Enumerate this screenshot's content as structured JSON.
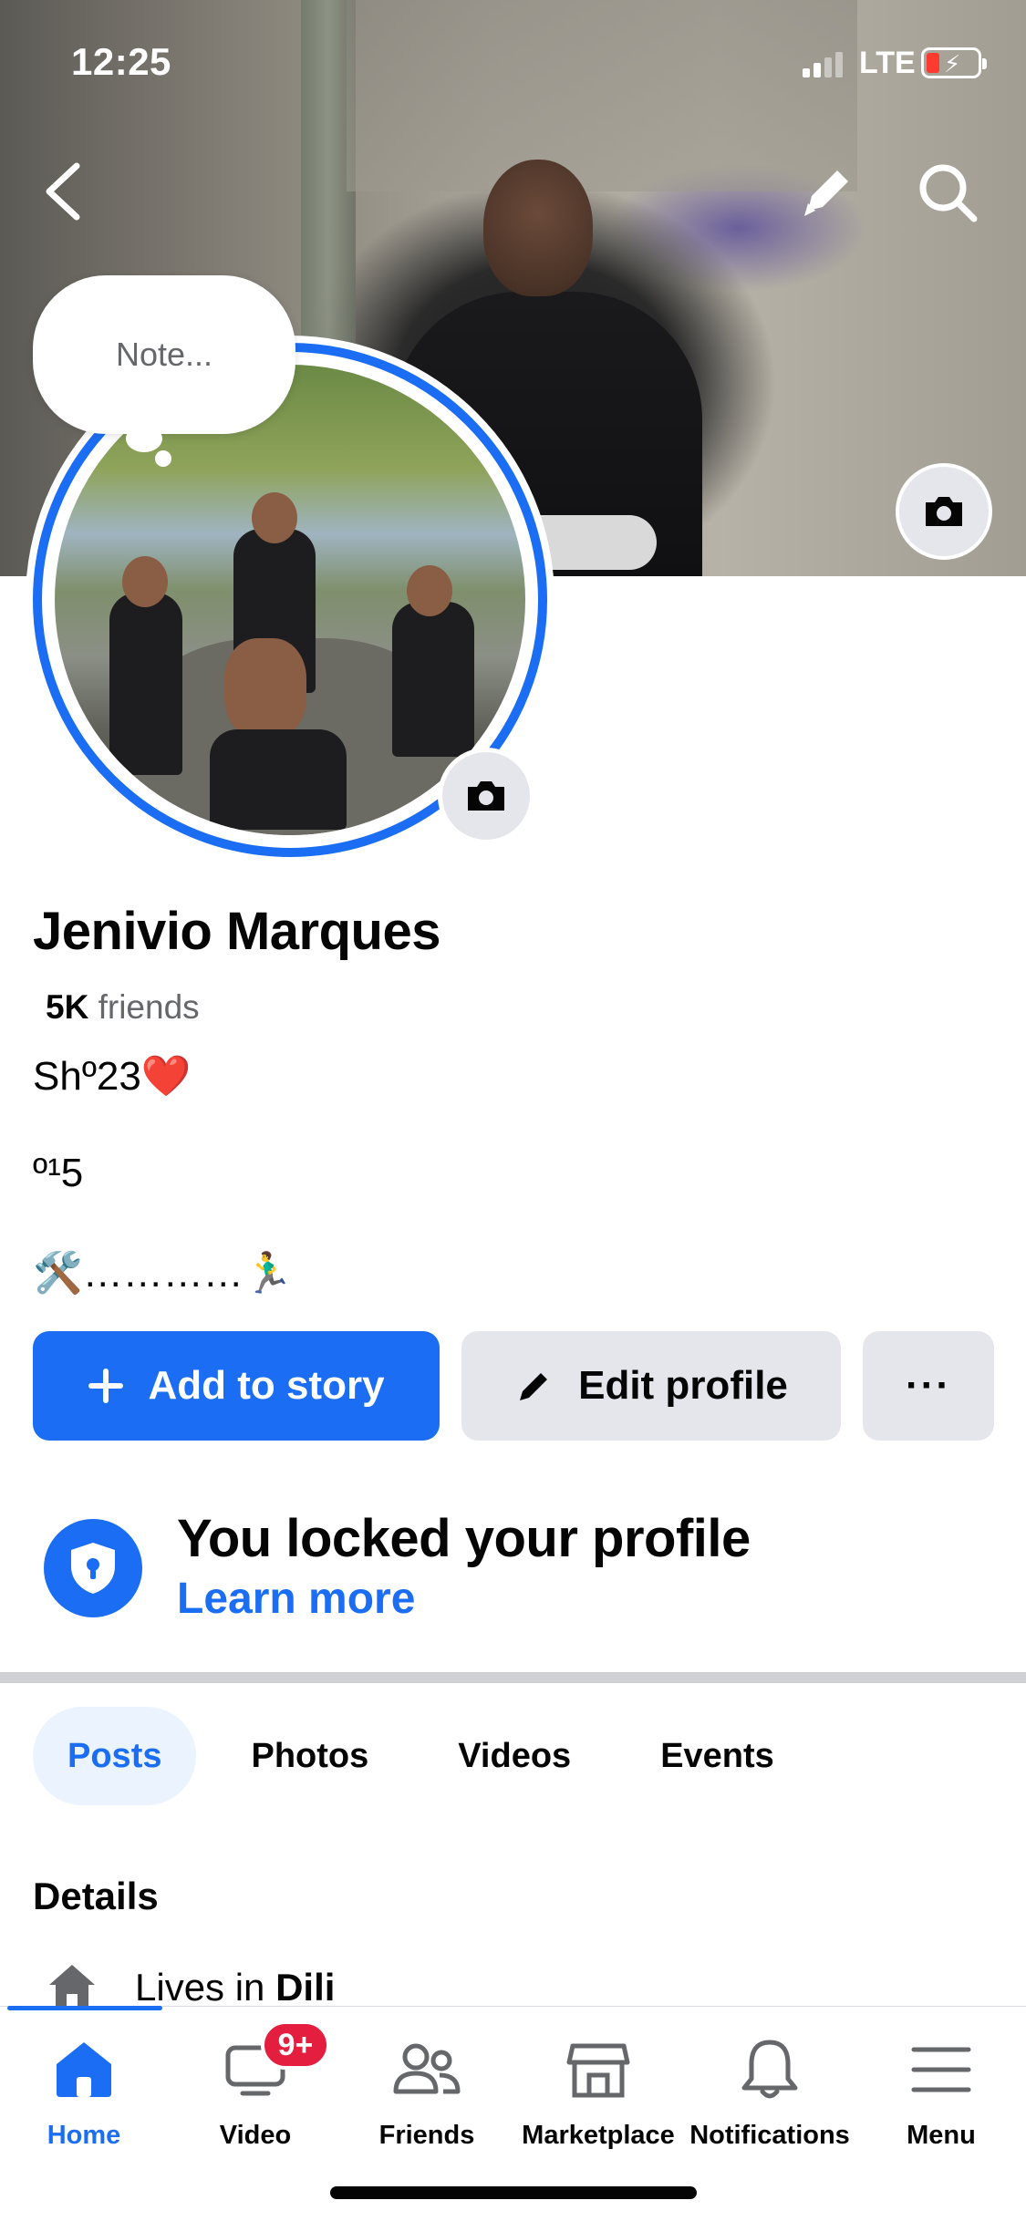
{
  "status_bar": {
    "time": "12:25",
    "network": "LTE"
  },
  "cover": {
    "has_camera": true
  },
  "note": {
    "placeholder": "Note..."
  },
  "profile": {
    "name": "Jenivio Marques",
    "friends_count": "5K",
    "friends_label": "friends",
    "bio_lines": [
      "Shº23❤️",
      "º¹5",
      "🛠️…………🏃‍♂️"
    ]
  },
  "actions": {
    "add_story": "Add to story",
    "edit_profile": "Edit profile",
    "more": "···"
  },
  "lock_notice": {
    "title": "You locked your profile",
    "link": "Learn more"
  },
  "tabs": [
    {
      "label": "Posts",
      "active": true
    },
    {
      "label": "Photos",
      "active": false
    },
    {
      "label": "Videos",
      "active": false
    },
    {
      "label": "Events",
      "active": false
    }
  ],
  "details": {
    "heading": "Details",
    "lives_prefix": "Lives in",
    "lives_city": "Dili"
  },
  "bottom_nav": [
    {
      "label": "Home",
      "icon": "home-icon",
      "active": true
    },
    {
      "label": "Video",
      "icon": "video-icon",
      "badge": "9+"
    },
    {
      "label": "Friends",
      "icon": "friends-icon"
    },
    {
      "label": "Marketplace",
      "icon": "marketplace-icon"
    },
    {
      "label": "Notifications",
      "icon": "bell-icon"
    },
    {
      "label": "Menu",
      "icon": "menu-icon"
    }
  ],
  "colors": {
    "accent": "#1b6ef3",
    "badge": "#e41e3f",
    "button_gray": "#e4e6eb",
    "text_secondary": "#65676b"
  }
}
